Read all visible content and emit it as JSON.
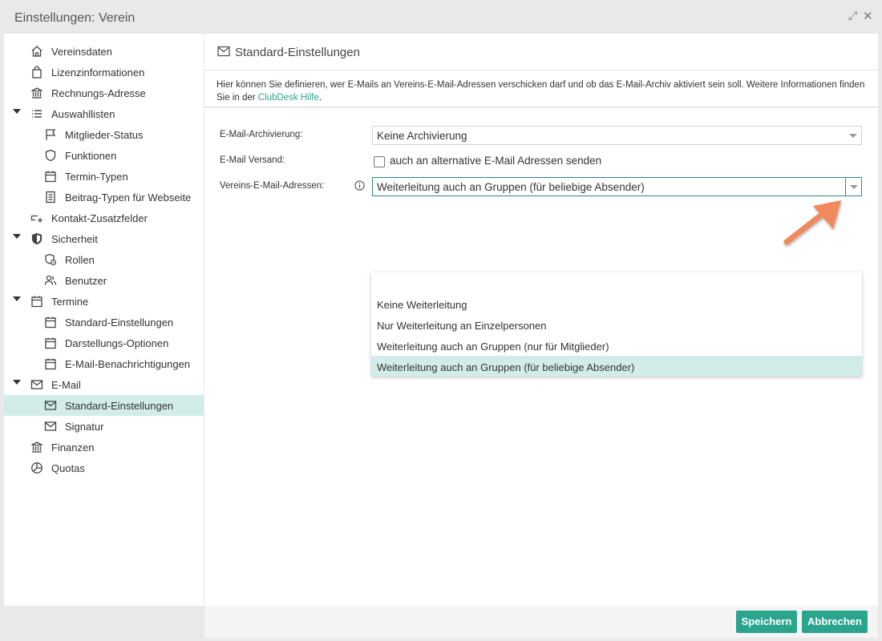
{
  "window": {
    "title": "Einstellungen: Verein",
    "expand_icon": "expand-icon",
    "close_icon": "close-icon"
  },
  "sidebar": {
    "items": [
      {
        "label": "Vereinsdaten",
        "icon": "home-icon"
      },
      {
        "label": "Lizenzinformationen",
        "icon": "shopping-bag-icon"
      },
      {
        "label": "Rechnungs-Adresse",
        "icon": "bank-icon"
      },
      {
        "label": "Auswahllisten",
        "icon": "list-icon",
        "expanded": true
      },
      {
        "label": "Mitglieder-Status",
        "icon": "flag-icon"
      },
      {
        "label": "Funktionen",
        "icon": "shield-icon"
      },
      {
        "label": "Termin-Typen",
        "icon": "calendar-icon"
      },
      {
        "label": "Beitrag-Typen für Webseite",
        "icon": "document-icon"
      },
      {
        "label": "Kontakt-Zusatzfelder",
        "icon": "field-plus-icon"
      },
      {
        "label": "Sicherheit",
        "icon": "security-shield-icon",
        "expanded": true
      },
      {
        "label": "Rollen",
        "icon": "role-icon"
      },
      {
        "label": "Benutzer",
        "icon": "users-icon"
      },
      {
        "label": "Termine",
        "icon": "calendar-icon",
        "expanded": true
      },
      {
        "label": "Standard-Einstellungen",
        "icon": "calendar-icon"
      },
      {
        "label": "Darstellungs-Optionen",
        "icon": "calendar-icon"
      },
      {
        "label": "E-Mail-Benachrichtigungen",
        "icon": "calendar-icon"
      },
      {
        "label": "E-Mail",
        "icon": "mail-icon",
        "expanded": true
      },
      {
        "label": "Standard-Einstellungen",
        "icon": "mail-icon",
        "selected": true
      },
      {
        "label": "Signatur",
        "icon": "mail-icon"
      },
      {
        "label": "Finanzen",
        "icon": "bank-icon"
      },
      {
        "label": "Quotas",
        "icon": "pie-chart-icon"
      }
    ]
  },
  "panel": {
    "title": "Standard-Einstellungen",
    "info_text": "Hier können Sie definieren, wer E-Mails an Vereins-E-Mail-Adressen verschicken darf und ob das E-Mail-Archiv aktiviert sein soll. Weitere Informationen finden Sie in der ",
    "info_link": "ClubDesk Hilfe",
    "info_suffix": "."
  },
  "form": {
    "archiving_label": "E-Mail-Archivierung:",
    "archiving_value": "Keine Archivierung",
    "send_label": "E-Mail Versand:",
    "send_checkbox_label": "auch an alternative E-Mail Adressen senden",
    "send_checked": false,
    "addresses_label": "Vereins-E-Mail-Adressen:",
    "addresses_value": "Weiterleitung auch an Gruppen (für beliebige Absender)"
  },
  "dropdown": {
    "options": [
      "Keine Weiterleitung",
      "Nur Weiterleitung an Einzelpersonen",
      "Weiterleitung auch an Gruppen (nur für Mitglieder)",
      "Weiterleitung auch an Gruppen (für beliebige Absender)"
    ],
    "selected_index": 3
  },
  "buttons": {
    "save": "Speichern",
    "cancel": "Abbrechen"
  },
  "colors": {
    "accent": "#2ba48e",
    "selection": "#d2ede9",
    "annotation_arrow": "#f08a5d"
  }
}
